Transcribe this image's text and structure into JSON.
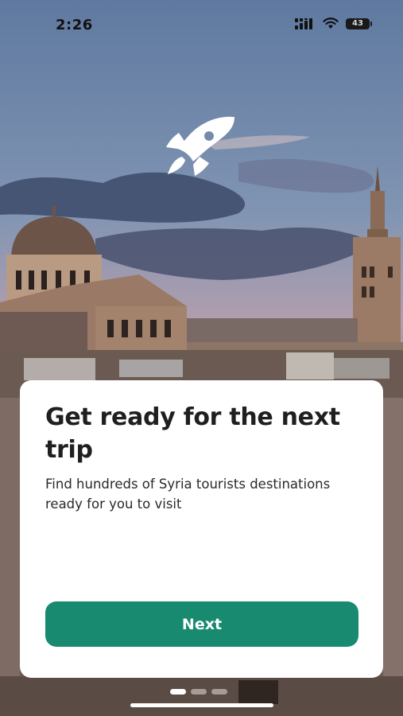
{
  "status_bar": {
    "time": "2:26",
    "battery": "43"
  },
  "onboarding": {
    "title": "Get ready for the next trip",
    "description": "Find hundreds of Syria tourists destinations ready for you to visit",
    "next_label": "Next",
    "page_count": 3,
    "current_page": 1
  },
  "icons": {
    "logo": "rocket-icon",
    "signal": "cellular-signal-icon",
    "wifi": "wifi-icon",
    "battery": "battery-icon"
  },
  "colors": {
    "primary": "#178a6f",
    "card": "#ffffff",
    "title_text": "#1f1f1f"
  }
}
